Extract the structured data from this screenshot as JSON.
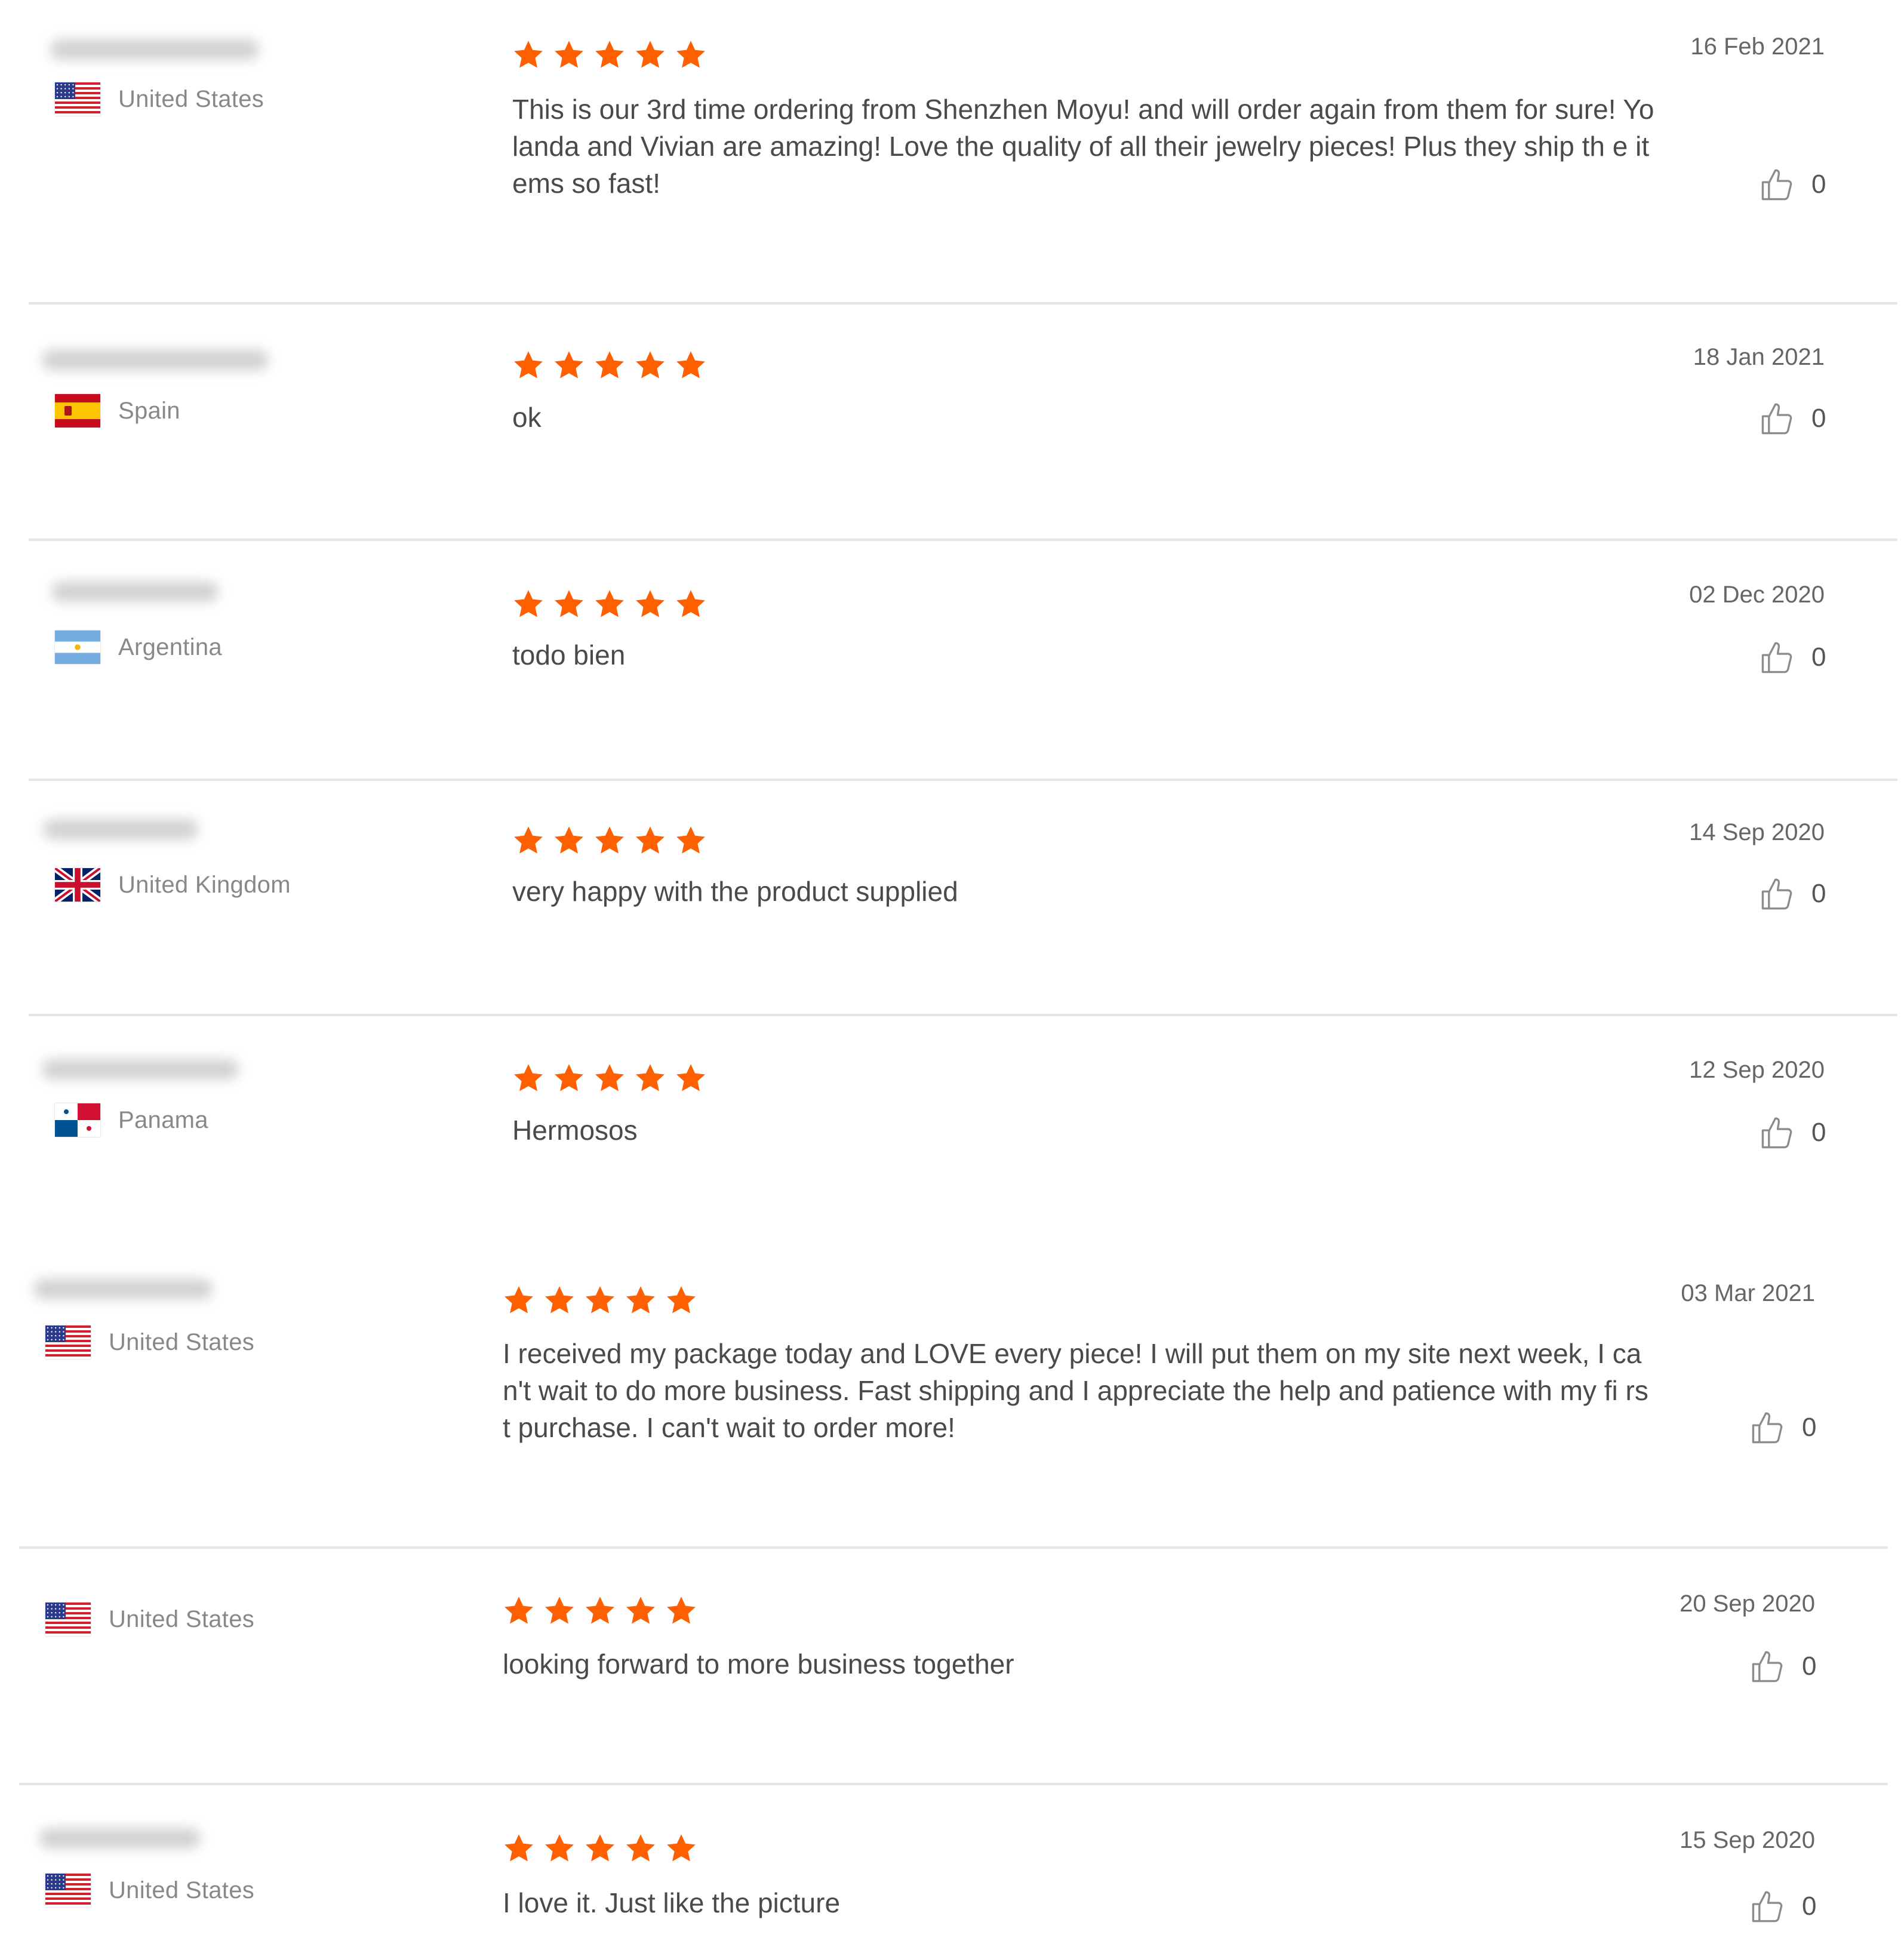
{
  "reviews": [
    {
      "country": "United States",
      "flag": "us",
      "rating": 5,
      "comment": "This is our 3rd time ordering from Shenzhen Moyu! and will order again from them for sure! Yolanda and Vivian are amazing! Love the quality of all their jewelry pieces! Plus they ship th e items so fast!",
      "date": "16 Feb 2021",
      "likes": "0"
    },
    {
      "country": "Spain",
      "flag": "es",
      "rating": 5,
      "comment": "ok",
      "date": "18 Jan 2021",
      "likes": "0"
    },
    {
      "country": "Argentina",
      "flag": "ar",
      "rating": 5,
      "comment": "todo bien",
      "date": "02 Dec 2020",
      "likes": "0"
    },
    {
      "country": "United Kingdom",
      "flag": "gb",
      "rating": 5,
      "comment": "very happy with the product supplied",
      "date": "14 Sep 2020",
      "likes": "0"
    },
    {
      "country": "Panama",
      "flag": "pa",
      "rating": 5,
      "comment": "Hermosos",
      "date": "12 Sep 2020",
      "likes": "0"
    },
    {
      "country": "United States",
      "flag": "us",
      "rating": 5,
      "comment": "I received my package today and LOVE every piece! I will put them on my site next week, I ca n't wait to do more business. Fast shipping and I appreciate the help and patience with my fi rst purchase. I can't wait to order more!",
      "date": "03 Mar 2021",
      "likes": "0"
    },
    {
      "country": "United States",
      "flag": "us",
      "rating": 5,
      "comment": "looking forward to more business together",
      "date": "20 Sep 2020",
      "likes": "0"
    },
    {
      "country": "United States",
      "flag": "us",
      "rating": 5,
      "comment": "I love it. Just like the picture",
      "date": "15 Sep 2020",
      "likes": "0"
    }
  ],
  "colors": {
    "star": "#fe5f00",
    "divider": "#e6e6e6",
    "country_text": "#888888",
    "comment_text": "#4a4a4a"
  },
  "icons": {
    "star": "star-icon",
    "like": "thumbs-up-icon"
  }
}
